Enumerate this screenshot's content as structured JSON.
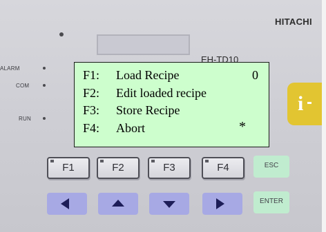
{
  "panel": {
    "brand": "HITACHI",
    "model": "EH-TD10",
    "indicators": {
      "alarm": "ALARM",
      "com": "COM",
      "run": "RUN"
    },
    "info_key_label": "i"
  },
  "screen": {
    "menu": [
      {
        "key": "F1:",
        "text": "Load Recipe"
      },
      {
        "key": "F2:",
        "text": "Edit loaded recipe"
      },
      {
        "key": "F3:",
        "text": "Store Recipe"
      },
      {
        "key": "F4:",
        "text": "Abort"
      }
    ],
    "selected_number": "0",
    "cursor_mark": "*"
  },
  "keys": {
    "function": [
      "F1",
      "F2",
      "F3",
      "F4"
    ],
    "esc": "ESC",
    "enter": "ENTER",
    "arrows": [
      "left-arrow-icon",
      "up-arrow-icon",
      "down-arrow-icon",
      "right-arrow-icon"
    ]
  },
  "colors": {
    "screen_bg": "#cdfecd",
    "panel_bg": "#cfcfd5",
    "arrow_key": "#a7a9e4",
    "esc_enter_key": "#c0eccf",
    "info_key": "#e2c531"
  }
}
